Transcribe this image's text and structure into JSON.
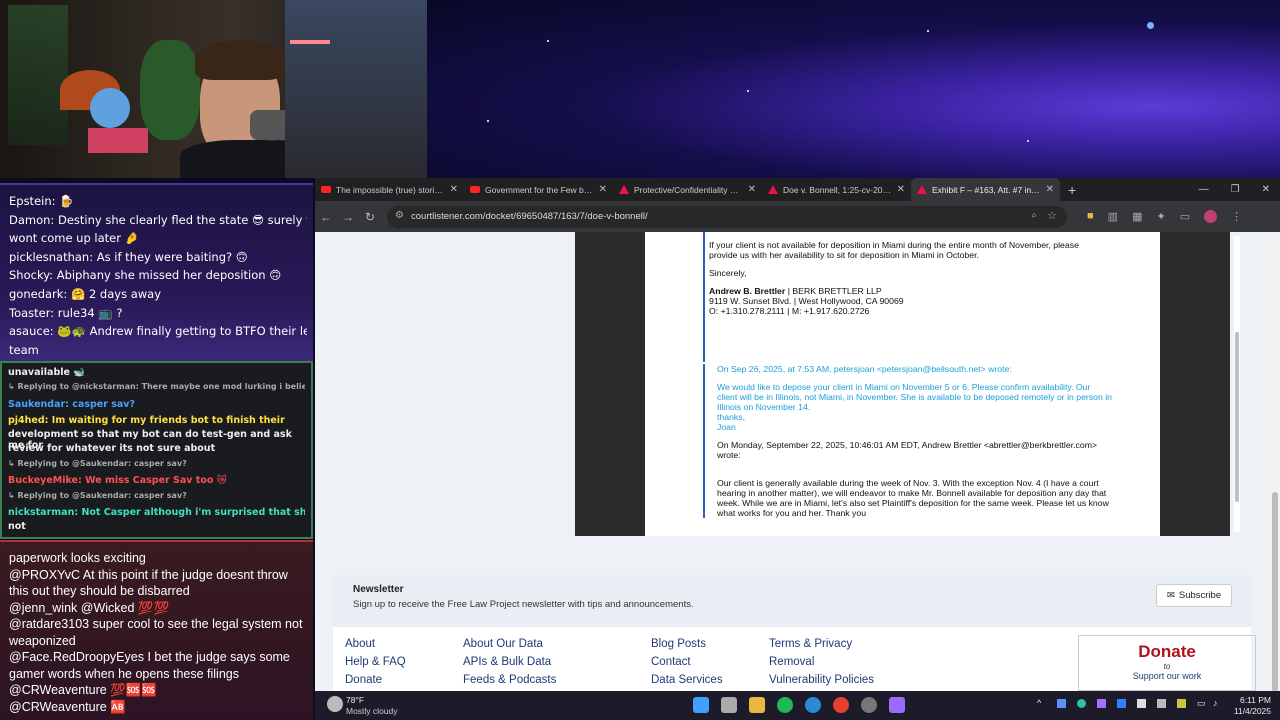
{
  "chat_top": {
    "lines": [
      "Epstein: 🍺",
      "Damon: Destiny she clearly fled the state 😎 surely that",
      "wont come up later 🤌",
      "picklesnathan: As if they were baiting? 🙃",
      "Shocky: Abiphany she missed her deposition 🙃",
      "gonedark: 🤗 2 days away",
      "Toaster: rule34 📺 ?",
      "asauce: 🐸🐢 Andrew finally getting to BTFO their legal",
      "team"
    ]
  },
  "chat_mid": {
    "lines": [
      "unavailable 🐋",
      "↳ Replying to @nickstarman: There maybe one mod lurking i believe forget th...",
      "Saukendar: casper sav?",
      "pj4hed: Im waiting for my friends bot to finish their",
      "development so that my bot can do test-gen and ask me for",
      "review for whatever its not sure about",
      "↳ Replying to @Saukendar: casper sav?",
      "BuckeyeMike: We miss Casper Sav too 😿",
      "↳ Replying to @Saukendar: casper sav?",
      "nickstarman: Not Casper although i'm surprised that she's",
      "not"
    ]
  },
  "chat_bottom": {
    "lines": [
      "paperwork looks exciting",
      "@PROXYvC At this point if the judge doesnt throw",
      "this out they should be disbarred",
      "@jenn_wink @Wicked 💯💯",
      "@ratdare3103 super cool to see the legal system not",
      "weaponized",
      "@Face.RedDroopyEyes I bet the judge says some",
      "gamer words when he opens these filings",
      "@CRWeaventure 💯🆘🆘",
      "@CRWeaventure 🆎"
    ]
  },
  "browser": {
    "tabs": [
      {
        "title": "The impossible (true) stories be",
        "icon": "youtube-icon"
      },
      {
        "title": "Government for the Few by the",
        "icon": "youtube-icon"
      },
      {
        "title": "Protective/Confidentiality Orde",
        "icon": "pdf-icon"
      },
      {
        "title": "Doe v. Bonnell, 1:25-cv-20757 -",
        "icon": "pdf-icon"
      },
      {
        "title": "Exhibit F – #163, Att. #7 in Doe",
        "icon": "pdf-icon"
      }
    ],
    "new_tab": "+",
    "url": "courtlistener.com/docket/69650487/163/7/doe-v-bonnell/"
  },
  "document": {
    "p1": "If your client is not available for deposition in Miami during the entire month of November, please provide us with her availability to sit for deposition in Miami in October.",
    "sincerely": "Sincerely,",
    "sig_name": "Andrew B. Brettler",
    "sig_firm": " | BERK BRETTLER LLP",
    "sig_addr": "9119 W. Sunset Blvd. | West Hollywood, CA 90069",
    "sig_phone": "O: +1.310.278.2111 | M: +1.917.620.2726",
    "quote_header": "On Sep 26, 2025, at 7:53 AM, petersjoan <petersjoan@bellsouth.net> wrote:",
    "quote_body": "We would like to depose your client in Miami on November 5 or 6. Please confirm availability. Our client will be in Illinois, not Miami, in November. She is available to be deposed remotely or in person in Illinois on November 14.",
    "quote_thanks": "thanks,",
    "quote_sign": "Joan",
    "q2_header": "On Monday, September 22, 2025, 10:46:01 AM EDT, Andrew Brettler <abrettler@berkbrettler.com> wrote:",
    "q2_body": "Our client is generally available during the week of Nov. 3.  With the exception Nov. 4 (I have a court hearing in another matter), we will endeavor to make Mr. Bonnell available for deposition any day that week.  While we are in Miami, let's also set Plaintiff's deposition for the same week.  Please let us know what works for you and her.  Thank you"
  },
  "newsletter": {
    "title": "Newsletter",
    "desc": "Sign up to receive the Free Law Project newsletter with tips and announcements.",
    "button": "Subscribe"
  },
  "footer": {
    "col1": [
      "About",
      "Help & FAQ",
      "Donate"
    ],
    "col2": [
      "About Our Data",
      "APIs & Bulk Data",
      "Feeds & Podcasts"
    ],
    "col3": [
      "Blog Posts",
      "Contact",
      "Data Services"
    ],
    "col4": [
      "Terms & Privacy",
      "Removal",
      "Vulnerability Policies"
    ],
    "donate_title": "Donate",
    "donate_to": "to",
    "donate_sub": "Support our work"
  },
  "taskbar": {
    "temp": "78°F",
    "weather": "Mostly cloudy",
    "time": "6:11 PM",
    "date": "11/4/2025"
  },
  "colors": {
    "accent_blue": "#1a9fd8",
    "link": "#1e3a78",
    "donate_red": "#b0121b"
  }
}
